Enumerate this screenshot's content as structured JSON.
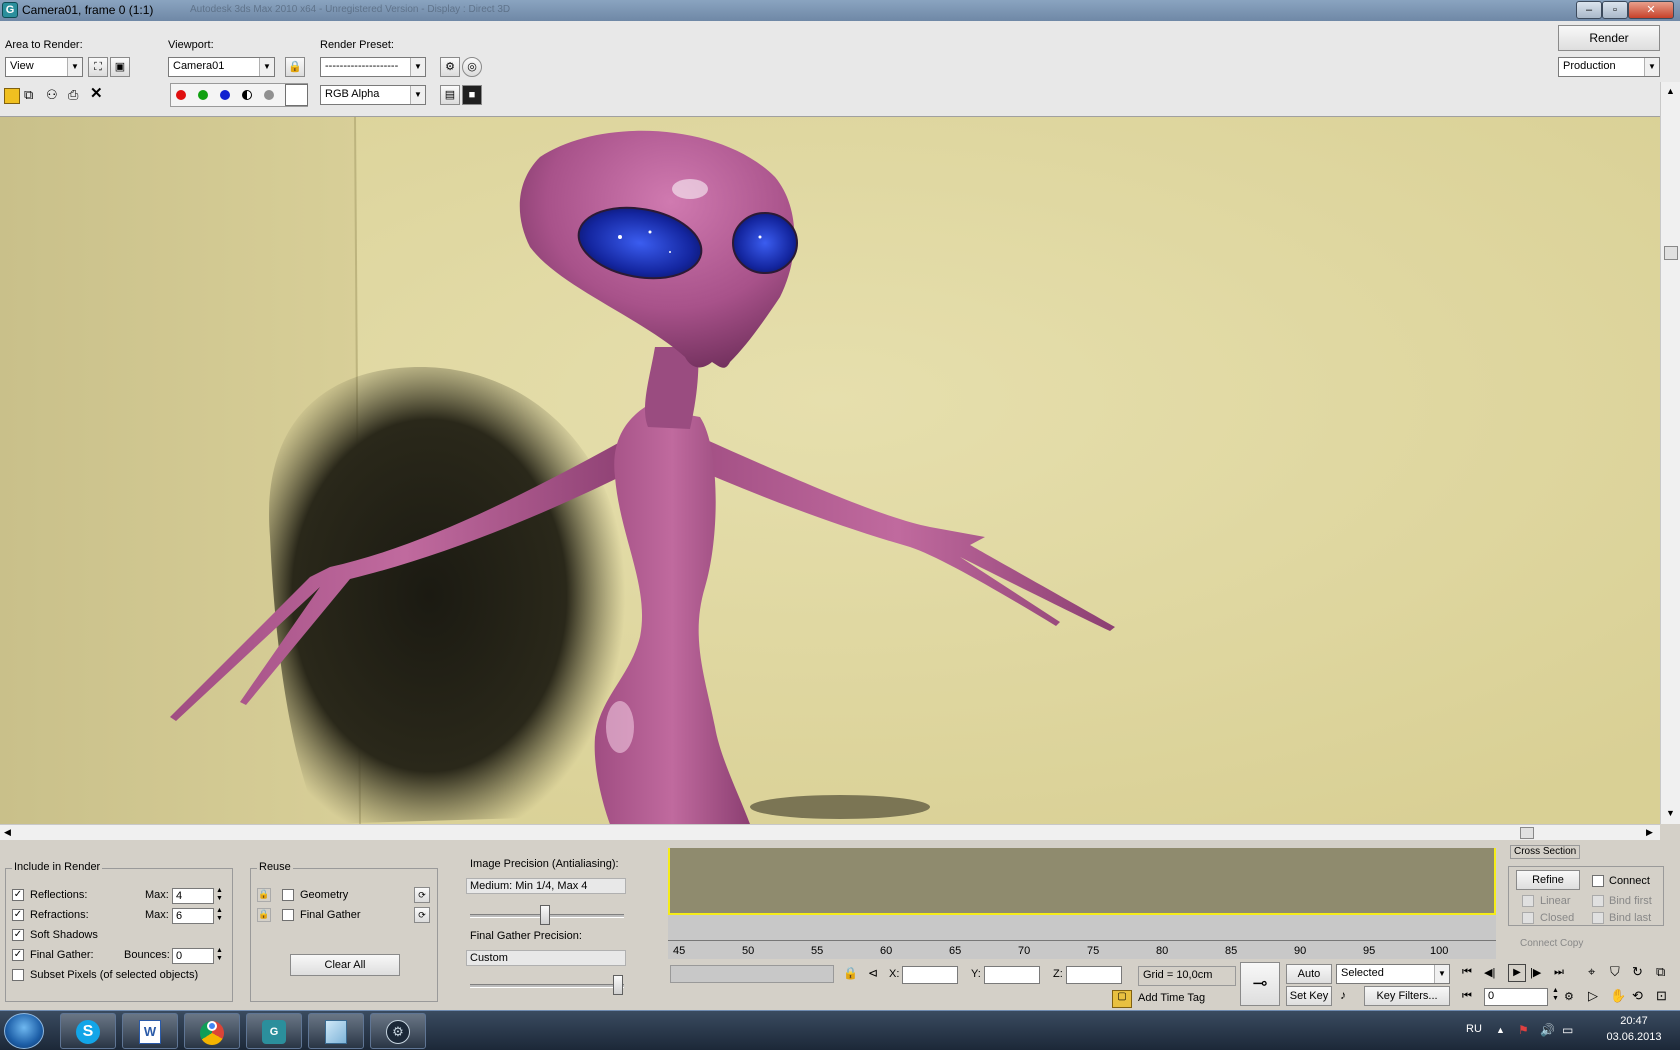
{
  "window": {
    "title": "Camera01, frame 0 (1:1)",
    "app_icon": "3ds-max-icon",
    "subtitle_blur": "Autodesk 3ds Max 2010 x64 - Unregistered Version - Display : Direct 3D"
  },
  "toolbar": {
    "area_label": "Area to Render:",
    "area_value": "View",
    "viewport_label": "Viewport:",
    "viewport_value": "Camera01",
    "preset_label": "Render Preset:",
    "preset_value": "--------------------",
    "render_label": "Render",
    "render_mode_value": "Production",
    "channel_value": "RGB Alpha"
  },
  "include": {
    "title": "Include in Render",
    "reflections": "Reflections:",
    "refractions": "Refractions:",
    "max_label": "Max:",
    "max_reflections": "4",
    "max_refractions": "6",
    "soft_shadows": "Soft Shadows",
    "final_gather": "Final Gather:",
    "bounces_label": "Bounces:",
    "bounces": "0",
    "subset": "Subset Pixels (of selected objects)"
  },
  "reuse": {
    "title": "Reuse",
    "geometry": "Geometry",
    "final_gather": "Final Gather",
    "clear_all": "Clear All"
  },
  "precision": {
    "image_label": "Image Precision (Antialiasing):",
    "image_value": "Medium: Min 1/4, Max 4",
    "fg_label": "Final Gather Precision:",
    "fg_value": "Custom"
  },
  "timeline": {
    "ticks": [
      "45",
      "50",
      "55",
      "60",
      "65",
      "70",
      "75",
      "80",
      "85",
      "90",
      "95",
      "100"
    ]
  },
  "status": {
    "x_label": "X:",
    "y_label": "Y:",
    "z_label": "Z:",
    "grid": "Grid = 10,0cm",
    "add_time_tag": "Add Time Tag",
    "auto_key": "Auto Key",
    "set_key": "Set Key",
    "selected": "Selected",
    "key_filters": "Key Filters...",
    "frame": "0"
  },
  "right_panel": {
    "cross_section": "Cross Section",
    "refine": "Refine",
    "connect": "Connect",
    "linear": "Linear",
    "closed": "Closed",
    "bind_first": "Bind first",
    "bind_last": "Bind last",
    "connect_copy": "Connect Copy"
  },
  "taskbar": {
    "lang": "RU",
    "time": "20:47",
    "date": "03.06.2013",
    "apps": [
      "start-orb",
      "skype-icon",
      "word-icon",
      "chrome-icon",
      "3dsmax-icon",
      "notepad-icon",
      "steam-icon"
    ]
  },
  "colors": {
    "wall": "#e1d9a1",
    "alien": "#b0588e",
    "eyes": "#1a2fa8",
    "timeline_bg": "#8f8b6e",
    "timeline_border": "#f5ec1a"
  }
}
